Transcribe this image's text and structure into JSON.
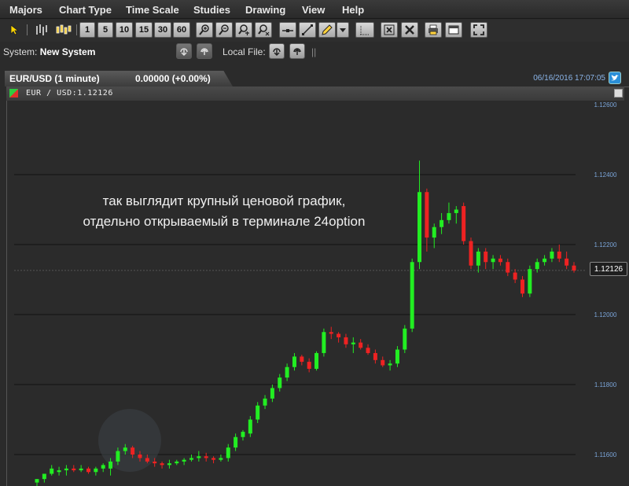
{
  "menu": [
    "Majors",
    "Chart Type",
    "Time Scale",
    "Studies",
    "Drawing",
    "View",
    "Help"
  ],
  "toolbar": {
    "timeframes": [
      "1",
      "5",
      "10",
      "15",
      "30",
      "60"
    ]
  },
  "system": {
    "label": "System:",
    "value": "New System",
    "local_file_label": "Local File:",
    "separator": "||"
  },
  "tab": {
    "title": "EUR/USD (1 minute)",
    "change": "0.00000 (+0.00%)"
  },
  "datetime": "06/16/2016 17:07:05",
  "symbol_line": "EUR / USD:1.12126",
  "overlay_text": [
    "так выглядит крупный ценовой график,",
    "отдельно открываемый в терминале 24option"
  ],
  "current_price_tag": "1.12126",
  "colors": {
    "up": "#22ee22",
    "down": "#ee2222",
    "grid": "#111111",
    "background": "#2b2b2b"
  },
  "chart_data": {
    "type": "candlestick",
    "y_ticks": [
      "1.12600",
      "1.12400",
      "1.12200",
      "1.12000",
      "1.11800",
      "1.11600"
    ],
    "ylim": [
      1.1152,
      1.126
    ],
    "current_price": 1.12126,
    "candles": [
      [
        1.1152,
        1.1153,
        1.1151,
        1.1153
      ],
      [
        1.1153,
        1.11545,
        1.1152,
        1.11545
      ],
      [
        1.11545,
        1.1157,
        1.1154,
        1.1156
      ],
      [
        1.1155,
        1.11565,
        1.1154,
        1.11555
      ],
      [
        1.11555,
        1.1157,
        1.1154,
        1.1156
      ],
      [
        1.1156,
        1.1157,
        1.1155,
        1.11555
      ],
      [
        1.11555,
        1.1157,
        1.1155,
        1.1156
      ],
      [
        1.1156,
        1.11565,
        1.11545,
        1.1155
      ],
      [
        1.1155,
        1.11565,
        1.1154,
        1.1156
      ],
      [
        1.1156,
        1.11575,
        1.1155,
        1.1157
      ],
      [
        1.1156,
        1.1159,
        1.1154,
        1.1158
      ],
      [
        1.1158,
        1.1162,
        1.1157,
        1.1161
      ],
      [
        1.1161,
        1.1163,
        1.116,
        1.1162
      ],
      [
        1.1162,
        1.11625,
        1.1159,
        1.116
      ],
      [
        1.116,
        1.1161,
        1.1158,
        1.1159
      ],
      [
        1.1159,
        1.116,
        1.11575,
        1.1158
      ],
      [
        1.1158,
        1.1159,
        1.11565,
        1.11575
      ],
      [
        1.11575,
        1.1158,
        1.1156,
        1.1157
      ],
      [
        1.1157,
        1.11585,
        1.1156,
        1.11575
      ],
      [
        1.11575,
        1.11585,
        1.1157,
        1.1158
      ],
      [
        1.1158,
        1.1159,
        1.1157,
        1.11585
      ],
      [
        1.11585,
        1.116,
        1.1158,
        1.1159
      ],
      [
        1.1159,
        1.1161,
        1.1158,
        1.11595
      ],
      [
        1.11595,
        1.11605,
        1.1158,
        1.1159
      ],
      [
        1.1159,
        1.11595,
        1.11575,
        1.11585
      ],
      [
        1.11585,
        1.116,
        1.1158,
        1.1159
      ],
      [
        1.1159,
        1.1163,
        1.1158,
        1.1162
      ],
      [
        1.1162,
        1.1166,
        1.1161,
        1.1165
      ],
      [
        1.1165,
        1.1167,
        1.1164,
        1.11665
      ],
      [
        1.1166,
        1.1171,
        1.1165,
        1.117
      ],
      [
        1.117,
        1.1175,
        1.1169,
        1.1174
      ],
      [
        1.1174,
        1.1177,
        1.1173,
        1.1176
      ],
      [
        1.1176,
        1.118,
        1.1175,
        1.1179
      ],
      [
        1.1179,
        1.1183,
        1.1178,
        1.1182
      ],
      [
        1.1182,
        1.1186,
        1.1181,
        1.1185
      ],
      [
        1.1185,
        1.1189,
        1.1184,
        1.1188
      ],
      [
        1.1188,
        1.11885,
        1.11855,
        1.11865
      ],
      [
        1.11865,
        1.11875,
        1.11835,
        1.11845
      ],
      [
        1.11845,
        1.11895,
        1.1184,
        1.1189
      ],
      [
        1.1189,
        1.1196,
        1.1188,
        1.1195
      ],
      [
        1.1195,
        1.11965,
        1.1193,
        1.11945
      ],
      [
        1.11945,
        1.1195,
        1.1192,
        1.11935
      ],
      [
        1.11935,
        1.11945,
        1.11905,
        1.11915
      ],
      [
        1.11915,
        1.11935,
        1.1189,
        1.1192
      ],
      [
        1.1192,
        1.1193,
        1.119,
        1.11905
      ],
      [
        1.11905,
        1.11915,
        1.11885,
        1.1189
      ],
      [
        1.1189,
        1.119,
        1.1186,
        1.1187
      ],
      [
        1.1187,
        1.1188,
        1.1185,
        1.11855
      ],
      [
        1.11855,
        1.1187,
        1.1184,
        1.1186
      ],
      [
        1.1186,
        1.1191,
        1.1185,
        1.119
      ],
      [
        1.119,
        1.1197,
        1.1189,
        1.1196
      ],
      [
        1.1196,
        1.1216,
        1.1195,
        1.1215
      ],
      [
        1.1215,
        1.1244,
        1.1213,
        1.1235
      ],
      [
        1.1235,
        1.1236,
        1.1218,
        1.1222
      ],
      [
        1.1222,
        1.1226,
        1.1219,
        1.1225
      ],
      [
        1.1225,
        1.1229,
        1.1223,
        1.1227
      ],
      [
        1.1227,
        1.1232,
        1.1226,
        1.1229
      ],
      [
        1.1229,
        1.1231,
        1.1226,
        1.123
      ],
      [
        1.1231,
        1.1232,
        1.122,
        1.1221
      ],
      [
        1.1221,
        1.1222,
        1.1213,
        1.1214
      ],
      [
        1.1214,
        1.1219,
        1.1212,
        1.1218
      ],
      [
        1.1218,
        1.1219,
        1.1213,
        1.1215
      ],
      [
        1.1215,
        1.1217,
        1.1213,
        1.1216
      ],
      [
        1.1216,
        1.1217,
        1.1214,
        1.1215
      ],
      [
        1.1215,
        1.1216,
        1.1211,
        1.1212
      ],
      [
        1.1212,
        1.1213,
        1.1209,
        1.121
      ],
      [
        1.121,
        1.1211,
        1.1205,
        1.1206
      ],
      [
        1.1206,
        1.1214,
        1.1205,
        1.1213
      ],
      [
        1.1213,
        1.1216,
        1.1212,
        1.1215
      ],
      [
        1.1215,
        1.1217,
        1.1214,
        1.1216
      ],
      [
        1.1216,
        1.1219,
        1.1215,
        1.1218
      ],
      [
        1.1218,
        1.122,
        1.1215,
        1.1216
      ],
      [
        1.1216,
        1.1218,
        1.1213,
        1.1214
      ],
      [
        1.1214,
        1.1215,
        1.1212,
        1.12126
      ]
    ]
  }
}
